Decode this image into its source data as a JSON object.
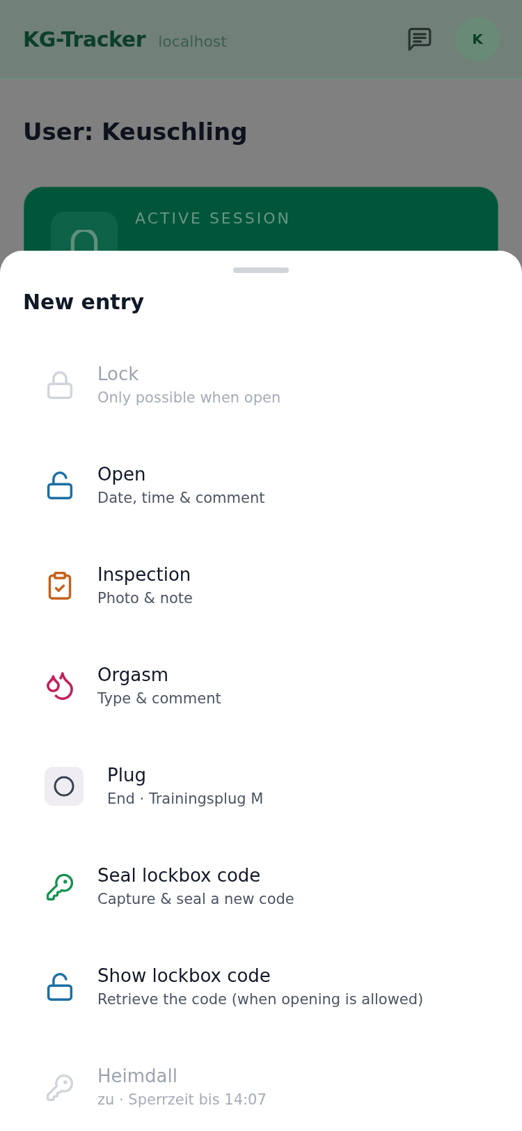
{
  "header": {
    "title": "KG-Tracker",
    "host": "localhost",
    "avatar": "K"
  },
  "page": {
    "title": "User: Keuschling",
    "session": {
      "label": "ACTIVE SESSION"
    }
  },
  "sheet": {
    "title": "New entry",
    "items": [
      {
        "kind": "lock",
        "title": "Lock",
        "subtitle": "Only possible when open",
        "disabled": true,
        "color": "#d1d5db"
      },
      {
        "kind": "open",
        "title": "Open",
        "subtitle": "Date, time & comment",
        "disabled": false,
        "color": "#1b6ea3"
      },
      {
        "kind": "inspection",
        "title": "Inspection",
        "subtitle": "Photo & note",
        "disabled": false,
        "color": "#c4621c"
      },
      {
        "kind": "orgasm",
        "title": "Orgasm",
        "subtitle": "Type & comment",
        "disabled": false,
        "color": "#c2205c"
      },
      {
        "kind": "plug",
        "title": "Plug",
        "subtitle": "End · Trainingsplug M",
        "disabled": false,
        "color": "#374151"
      },
      {
        "kind": "seal-code",
        "title": "Seal lockbox code",
        "subtitle": "Capture & seal a new code",
        "disabled": false,
        "color": "#17914f"
      },
      {
        "kind": "show-code",
        "title": "Show lockbox code",
        "subtitle": "Retrieve the code (when opening is allowed)",
        "disabled": false,
        "color": "#1b6ea3"
      },
      {
        "kind": "device",
        "title": "Heimdall",
        "subtitle": "zu · Sperrzeit bis 14:07",
        "disabled": true,
        "color": "#cfd4da"
      }
    ]
  }
}
